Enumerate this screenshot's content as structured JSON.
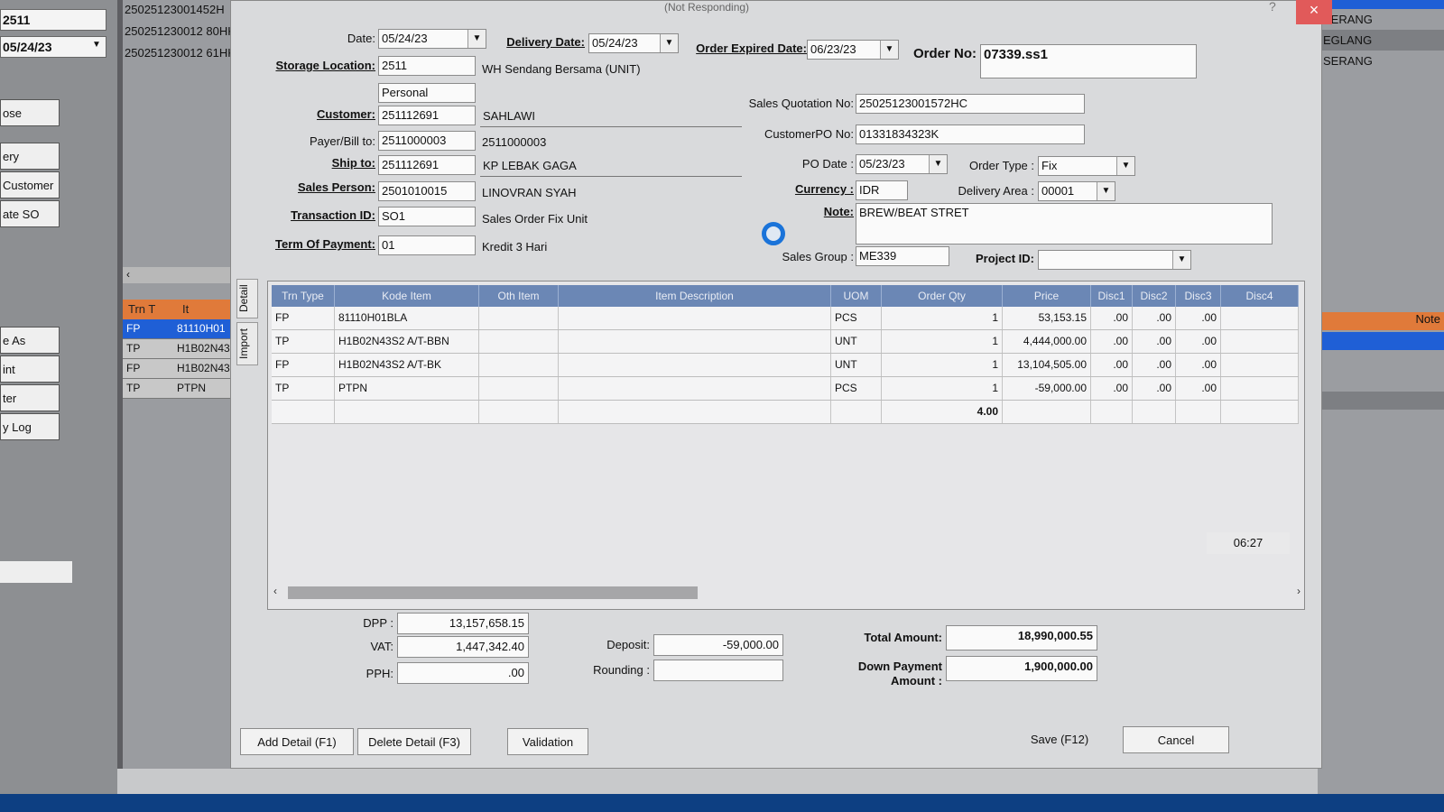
{
  "background": {
    "left_field_1": "2511",
    "left_field_2": "05/24/23",
    "left_buttons": [
      "ose",
      "ery",
      "Customer",
      "ate SO",
      "e As",
      "int",
      "ter",
      "y Log"
    ],
    "top_list": [
      "25025123001452H",
      "250251230012 80HK",
      "250251230012 61HK"
    ],
    "mini_grid_headers": [
      "Trn T",
      "It"
    ],
    "mini_grid_rows": [
      [
        "FP",
        "81110H01"
      ],
      [
        "TP",
        "H1B02N43"
      ],
      [
        "FP",
        "H1B02N43"
      ],
      [
        "TP",
        "PTPN"
      ]
    ],
    "right_list": [
      "SERANG",
      "EGLANG",
      "SERANG"
    ],
    "right_note_header": "Note"
  },
  "dialog": {
    "title": "(Not Responding)",
    "help": "?",
    "date_label": "Date:",
    "date": "05/24/23",
    "delivery_date_label": "Delivery Date:",
    "delivery_date": "05/24/23",
    "order_expired_label": "Order Expired Date:",
    "order_expired": "06/23/23",
    "order_no_label": "Order No:",
    "order_no": "07339.ss1",
    "storage_label": "Storage Location:",
    "storage": "2511",
    "storage_name": "WH Sendang Bersama (UNIT)",
    "personal": "Personal",
    "customer_label": "Customer:",
    "customer": "251112691",
    "customer_name": "SAHLAWI",
    "payer_label": "Payer/Bill to:",
    "payer": "2511000003",
    "payer_name": "2511000003",
    "ship_label": "Ship to:",
    "ship": "251112691",
    "ship_name": "KP LEBAK GAGA",
    "salesperson_label": "Sales Person:",
    "salesperson": "2501010015",
    "salesperson_name": "LINOVRAN SYAH",
    "trx_label": "Transaction ID:",
    "trx": "SO1",
    "trx_name": "Sales Order Fix Unit",
    "top_label": "Term Of Payment:",
    "top": "01",
    "top_name": "Kredit 3 Hari",
    "sq_label": "Sales Quotation No:",
    "sq": "25025123001572HC",
    "cpo_label": "CustomerPO No:",
    "cpo": "01331834323K",
    "podate_label": "PO Date :",
    "podate": "05/23/23",
    "ordertype_label": "Order Type :",
    "ordertype": "Fix",
    "currency_label": "Currency :",
    "currency": "IDR",
    "area_label": "Delivery Area :",
    "area": "00001",
    "note_label": "Note:",
    "note": "BREW/BEAT STRET",
    "salesgroup_label": "Sales Group :",
    "salesgroup": "ME339",
    "project_label": "Project ID:",
    "project": "",
    "tab_detail": "Detail",
    "tab_import": "Import",
    "time": "06:27"
  },
  "grid": {
    "headers": [
      "Trn Type",
      "Kode Item",
      "Oth Item",
      "Item Description",
      "UOM",
      "Order Qty",
      "Price",
      "Disc1",
      "Disc2",
      "Disc3",
      "Disc4"
    ],
    "rows": [
      [
        "FP",
        "81110H01BLA",
        "",
        "",
        "PCS",
        "1",
        "53,153.15",
        ".00",
        ".00",
        ".00",
        ""
      ],
      [
        "TP",
        "H1B02N43S2 A/T-BBN",
        "",
        "",
        "UNT",
        "1",
        "4,444,000.00",
        ".00",
        ".00",
        ".00",
        ""
      ],
      [
        "FP",
        "H1B02N43S2 A/T-BK",
        "",
        "",
        "UNT",
        "1",
        "13,104,505.00",
        ".00",
        ".00",
        ".00",
        ""
      ],
      [
        "TP",
        "PTPN",
        "",
        "",
        "PCS",
        "1",
        "-59,000.00",
        ".00",
        ".00",
        ".00",
        ""
      ]
    ],
    "total_qty": "4.00"
  },
  "totals": {
    "dpp_label": "DPP :",
    "dpp": "13,157,658.15",
    "vat_label": "VAT:",
    "vat": "1,447,342.40",
    "pph_label": "PPH:",
    "pph": ".00",
    "deposit_label": "Deposit:",
    "deposit": "-59,000.00",
    "rounding_label": "Rounding :",
    "rounding": "",
    "total_label": "Total Amount:",
    "total": "18,990,000.55",
    "dp_label_1": "Down Payment",
    "dp_label_2": "Amount :",
    "dp": "1,900,000.00"
  },
  "buttons": {
    "add": "Add Detail (F1)",
    "delete": "Delete Detail (F3)",
    "validation": "Validation",
    "save": "Save (F12)",
    "cancel": "Cancel"
  }
}
